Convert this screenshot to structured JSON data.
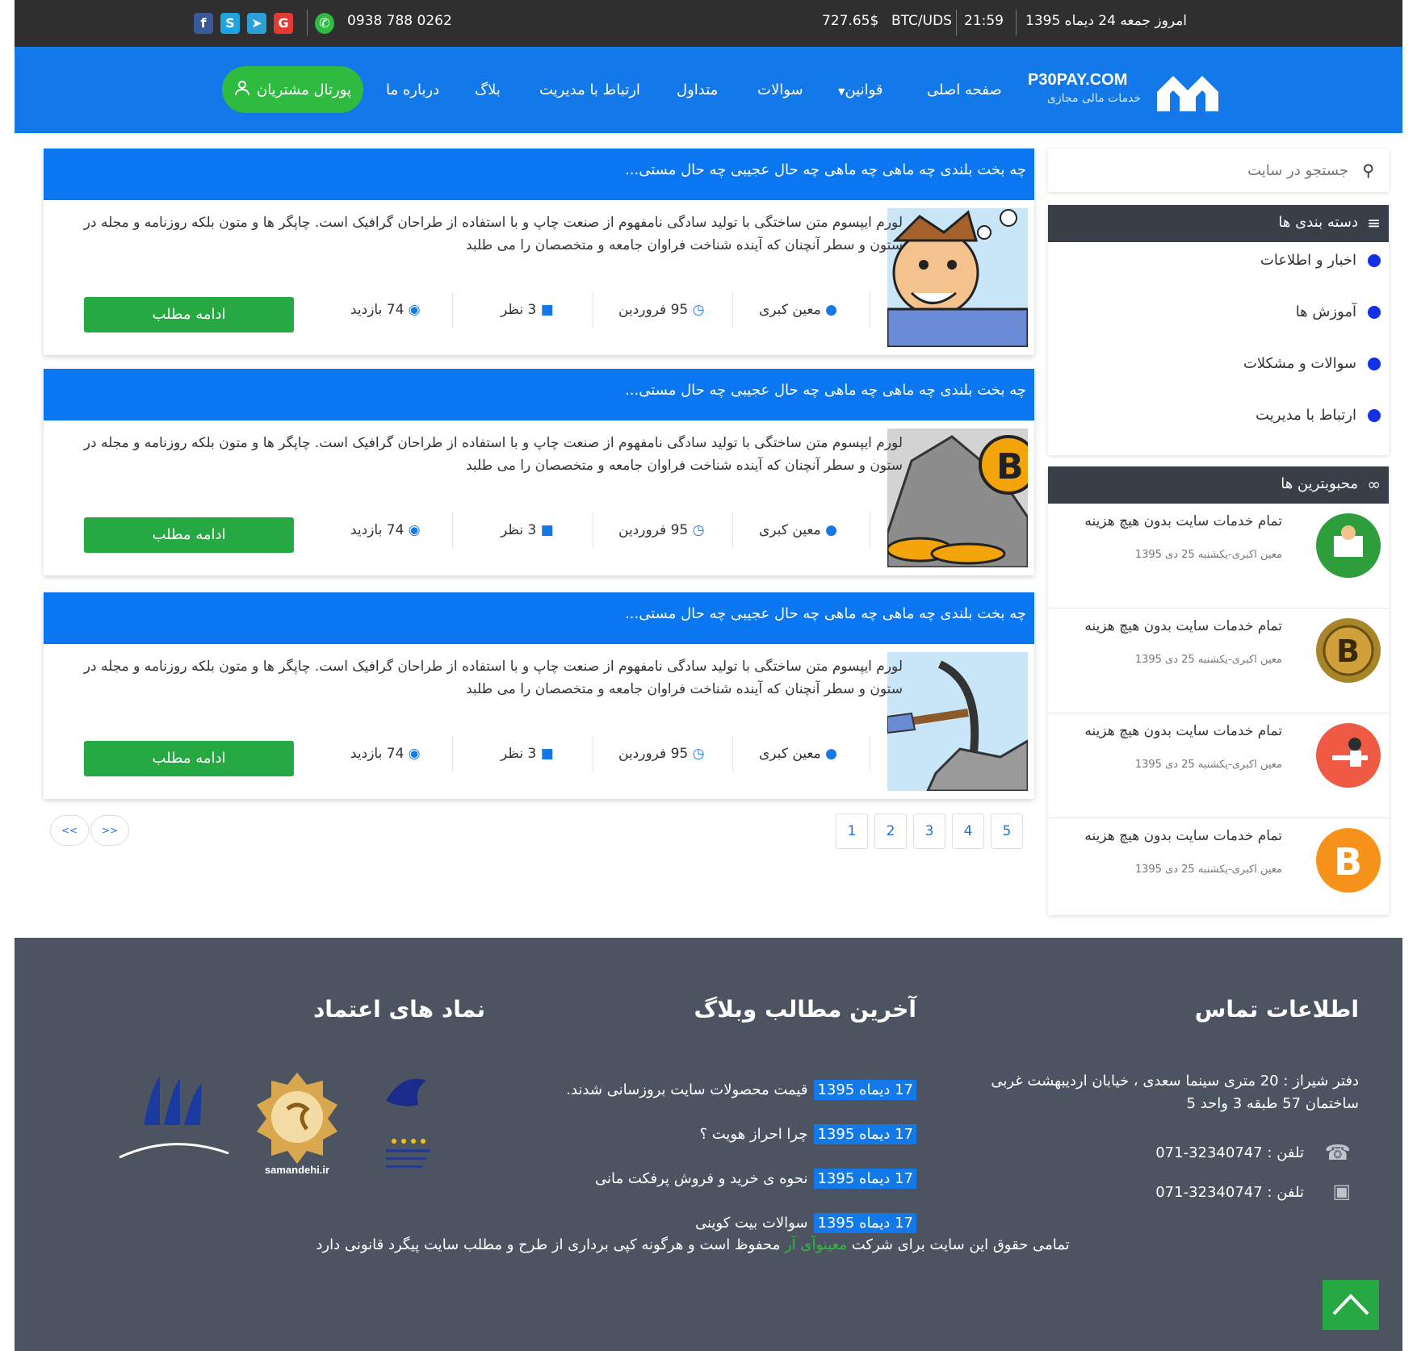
{
  "topbar": {
    "date": "امروز جمعه 24 دیماه 1395",
    "time": "21:59",
    "pair": "BTC/UDS",
    "price": "727.65$",
    "phone": "0938 788 0262",
    "social": [
      "facebook-icon",
      "skype-icon",
      "telegram-icon",
      "google-icon"
    ]
  },
  "nav": {
    "logo_title": "P30PAY.COM",
    "logo_sub": "خدمات مالی مجازی",
    "items": [
      "صفحه اصلی",
      "قوانین",
      "سوالات",
      "متداول",
      "ارتباط با مدیریت",
      "بلاگ",
      "درباره ما"
    ],
    "portal": "پورتال مشتریان"
  },
  "posts": [
    {
      "title": "چه بخت بلندی چه ماهی چه ماهی چه حال عجیبی چه حال مستی...",
      "excerpt": "لورم ایپسوم متن ساختگی با تولید سادگی نامفهوم از صنعت چاپ و با استفاده از طراحان گرافیک است. چاپگر ها و متون بلکه روزنامه و مجله در ستون و سطر آنچنان که آینده شناخت فراوان جامعه و متخصصان را می طلبد",
      "author": "معین کبری",
      "date": "95 فروردین",
      "comments": "3 نظر",
      "views": "74 بازدید",
      "more": "ادامه مطلب"
    },
    {
      "title": "چه بخت بلندی چه ماهی چه ماهی چه حال عجیبی چه حال مستی...",
      "excerpt": "لورم ایپسوم متن ساختگی با تولید سادگی نامفهوم از صنعت چاپ و با استفاده از طراحان گرافیک است. چاپگر ها و متون بلکه روزنامه و مجله در ستون و سطر آنچنان که آینده شناخت فراوان جامعه و متخصصان را می طلبد",
      "author": "معین کبری",
      "date": "95 فروردین",
      "comments": "3 نظر",
      "views": "74 بازدید",
      "more": "ادامه مطلب"
    },
    {
      "title": "چه بخت بلندی چه ماهی چه ماهی چه حال عجیبی چه حال مستی...",
      "excerpt": "لورم ایپسوم متن ساختگی با تولید سادگی نامفهوم از صنعت چاپ و با استفاده از طراحان گرافیک است. چاپگر ها و متون بلکه روزنامه و مجله در ستون و سطر آنچنان که آینده شناخت فراوان جامعه و متخصصان را می طلبد",
      "author": "معین کبری",
      "date": "95 فروردین",
      "comments": "3 نظر",
      "views": "74 بازدید",
      "more": "ادامه مطلب"
    }
  ],
  "pagination": {
    "pages": [
      "1",
      "2",
      "3",
      "4",
      "5"
    ],
    "prev": "<<",
    "next": ">>"
  },
  "sidebar": {
    "search_placeholder": "جستجو در سایت",
    "categories_title": "دسته بندی ها",
    "categories": [
      "اخبار و اطلاعات",
      "آموزش ها",
      "سوالات و مشکلات",
      "ارتباط با مدیریت"
    ],
    "popular_title": "محبوبترین ها",
    "popular": [
      {
        "title": "تمام خدمات سایت بدون هیچ هزینه",
        "meta": "معین اکبری-یکشنبه 25 دی 1395"
      },
      {
        "title": "تمام خدمات سایت بدون هیچ هزینه",
        "meta": "معین اکبری-یکشنبه 25 دی 1395"
      },
      {
        "title": "تمام خدمات سایت بدون هیچ هزینه",
        "meta": "معین اکبری-یکشنبه 25 دی 1395"
      },
      {
        "title": "تمام خدمات سایت بدون هیچ هزینه",
        "meta": "معین اکبری-یکشنبه 25 دی 1395"
      }
    ]
  },
  "footer": {
    "contact_title": "اطلاعات تماس",
    "address": "دفتر شیراز : 20 متری سینما سعدی ، خیابان اردیبهشت غربی ساختمان 57 طبقه 3 واحد 5",
    "phone1": "تلفن : 32340747-071",
    "phone2": "تلفن : 32340747-071",
    "blog_title": "آخرین مطالب وبلاگ",
    "blog": [
      {
        "date": "17 دیماه 1395",
        "text": "قیمت محصولات سایت بروزسانی شدند."
      },
      {
        "date": "17 دیماه 1395",
        "text": "چرا احراز هویت ؟"
      },
      {
        "date": "17 دیماه 1395",
        "text": "نحوه ی خرید و فروش پرفکت مانی"
      },
      {
        "date": "17 دیماه 1395",
        "text": "سوالات بیت کوینی"
      }
    ],
    "trust_title": "نماد های اعتماد",
    "trust_samandehi": "samandehi.ir",
    "copyright_a": "تمامی حقوق این سایت برای شرکت",
    "copyright_link": "معینوآی آر",
    "copyright_b": "محفوظ است و هرگونه کپی برداری از طرح و مطلب سایت پیگرد قانونی دارد"
  },
  "colors": {
    "blue": "#1479e8",
    "green": "#26a842",
    "dark": "#2f2f2f",
    "footer": "#4d5461"
  }
}
